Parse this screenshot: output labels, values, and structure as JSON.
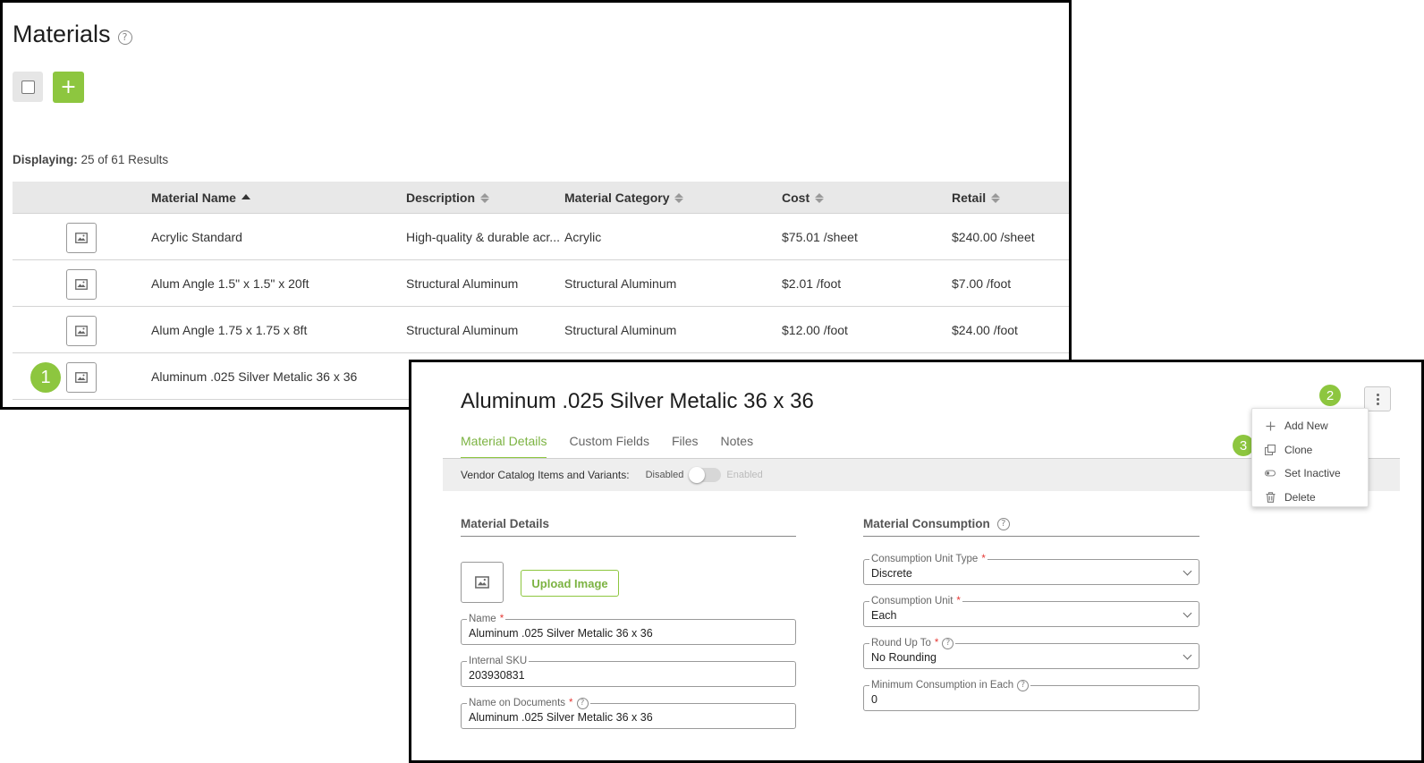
{
  "list": {
    "title": "Materials",
    "help_glyph": "?",
    "add_glyph": "+",
    "displaying_label": "Displaying:",
    "displaying_value": "25 of 61 Results",
    "columns": [
      "Material Name",
      "Description",
      "Material Category",
      "Cost",
      "Retail"
    ],
    "rows": [
      {
        "name": "Acrylic Standard",
        "description": "High-quality & durable acr...",
        "category": "Acrylic",
        "cost": "$75.01 /sheet",
        "retail": "$240.00 /sheet"
      },
      {
        "name": "Alum Angle 1.5\" x 1.5\" x 20ft",
        "description": "Structural Aluminum",
        "category": "Structural Aluminum",
        "cost": "$2.01 /foot",
        "retail": "$7.00 /foot"
      },
      {
        "name": "Alum Angle 1.75 x 1.75 x 8ft",
        "description": "Structural Aluminum",
        "category": "Structural Aluminum",
        "cost": "$12.00 /foot",
        "retail": "$24.00 /foot"
      },
      {
        "name": "Aluminum .025 Silver Metalic 36 x 36",
        "description": "",
        "category": "",
        "cost": "",
        "retail": ""
      }
    ]
  },
  "callouts": [
    "1",
    "2",
    "3"
  ],
  "detail": {
    "title": "Aluminum .025 Silver Metalic 36 x 36",
    "tabs": [
      "Material Details",
      "Custom Fields",
      "Files",
      "Notes"
    ],
    "vendor_label": "Vendor Catalog Items and Variants:",
    "toggle_off": "Disabled",
    "toggle_on": "Enabled",
    "material_details_heading": "Material Details",
    "upload_label": "Upload Image",
    "fields": {
      "name": {
        "label": "Name",
        "value": "Aluminum .025 Silver Metalic 36 x 36"
      },
      "sku": {
        "label": "Internal SKU",
        "value": "203930831"
      },
      "doc_name": {
        "label": "Name on Documents",
        "value": "Aluminum .025 Silver Metalic 36 x 36"
      }
    },
    "consumption_heading": "Material Consumption",
    "consumption": {
      "unit_type": {
        "label": "Consumption Unit Type",
        "value": "Discrete"
      },
      "unit": {
        "label": "Consumption Unit",
        "value": "Each"
      },
      "round": {
        "label": "Round Up To",
        "value": "No Rounding"
      },
      "min": {
        "label": "Minimum Consumption in Each",
        "value": "0"
      }
    },
    "required_mark": "*"
  },
  "menu": {
    "items": [
      {
        "label": "Add New",
        "icon": "plus-icon"
      },
      {
        "label": "Clone",
        "icon": "clone-icon"
      },
      {
        "label": "Set Inactive",
        "icon": "toggle-icon"
      },
      {
        "label": "Delete",
        "icon": "trash-icon"
      }
    ]
  },
  "colors": {
    "accent": "#8dc63f",
    "required": "#e53935"
  }
}
